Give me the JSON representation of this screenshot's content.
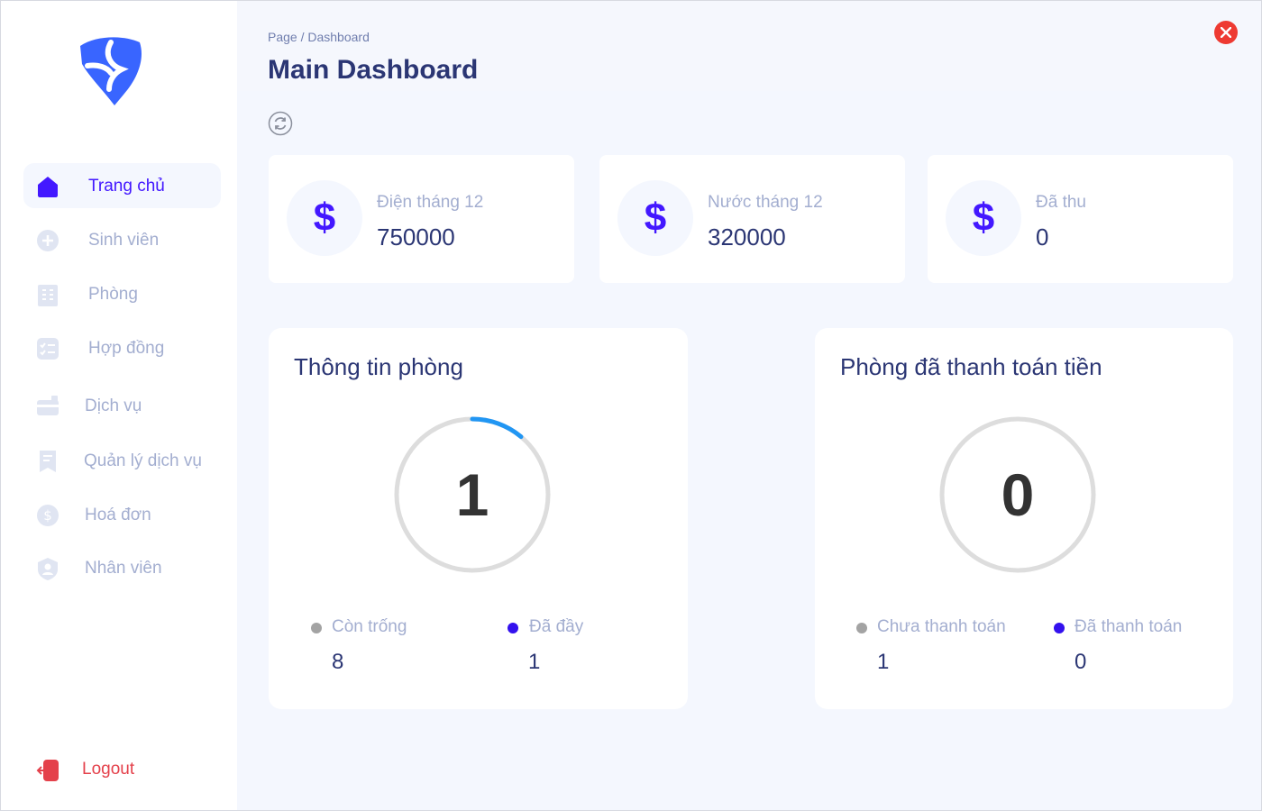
{
  "sidebar": {
    "items": [
      {
        "label": "Trang chủ",
        "icon": "home-icon",
        "active": true
      },
      {
        "label": "Sinh viên",
        "icon": "plus-circle-icon"
      },
      {
        "label": "Phòng",
        "icon": "building-icon"
      },
      {
        "label": "Hợp đồng",
        "icon": "checklist-icon"
      },
      {
        "label": "Dịch vụ",
        "icon": "card-icon"
      },
      {
        "label": "Quản lý dịch vụ",
        "icon": "receipt-icon"
      },
      {
        "label": "Hoá đơn",
        "icon": "dollar-circle-icon"
      },
      {
        "label": "Nhân viên",
        "icon": "user-shield-icon"
      }
    ],
    "logout_label": "Logout"
  },
  "header": {
    "breadcrumb": "Page / Dashboard",
    "title": "Main Dashboard"
  },
  "stats": [
    {
      "label": "Điện tháng 12",
      "value": "750000",
      "icon": "$"
    },
    {
      "label": "Nước tháng 12",
      "value": "320000",
      "icon": "$"
    },
    {
      "label": "Đã thu",
      "value": "0",
      "icon": "$"
    }
  ],
  "room_info": {
    "title": "Thông tin phòng",
    "center_value": "1",
    "progress_fraction": 0.111,
    "legend": [
      {
        "label": "Còn trống",
        "value": "8",
        "color": "#a3a3a3"
      },
      {
        "label": "Đã đầy",
        "value": "1",
        "color": "#3311ee"
      }
    ]
  },
  "payment_info": {
    "title": "Phòng đã thanh toán tiền",
    "center_value": "0",
    "progress_fraction": 0,
    "legend": [
      {
        "label": "Chưa thanh toán",
        "value": "1",
        "color": "#a3a3a3"
      },
      {
        "label": "Đã thanh toán",
        "value": "0",
        "color": "#3311ee"
      }
    ]
  },
  "colors": {
    "accent": "#4318ff",
    "title": "#2b3674",
    "muted": "#a3aed0",
    "gauge_track": "#dddddd",
    "gauge_fill": "#2196f3",
    "logout": "#e4414b",
    "close": "#ee3a32"
  }
}
